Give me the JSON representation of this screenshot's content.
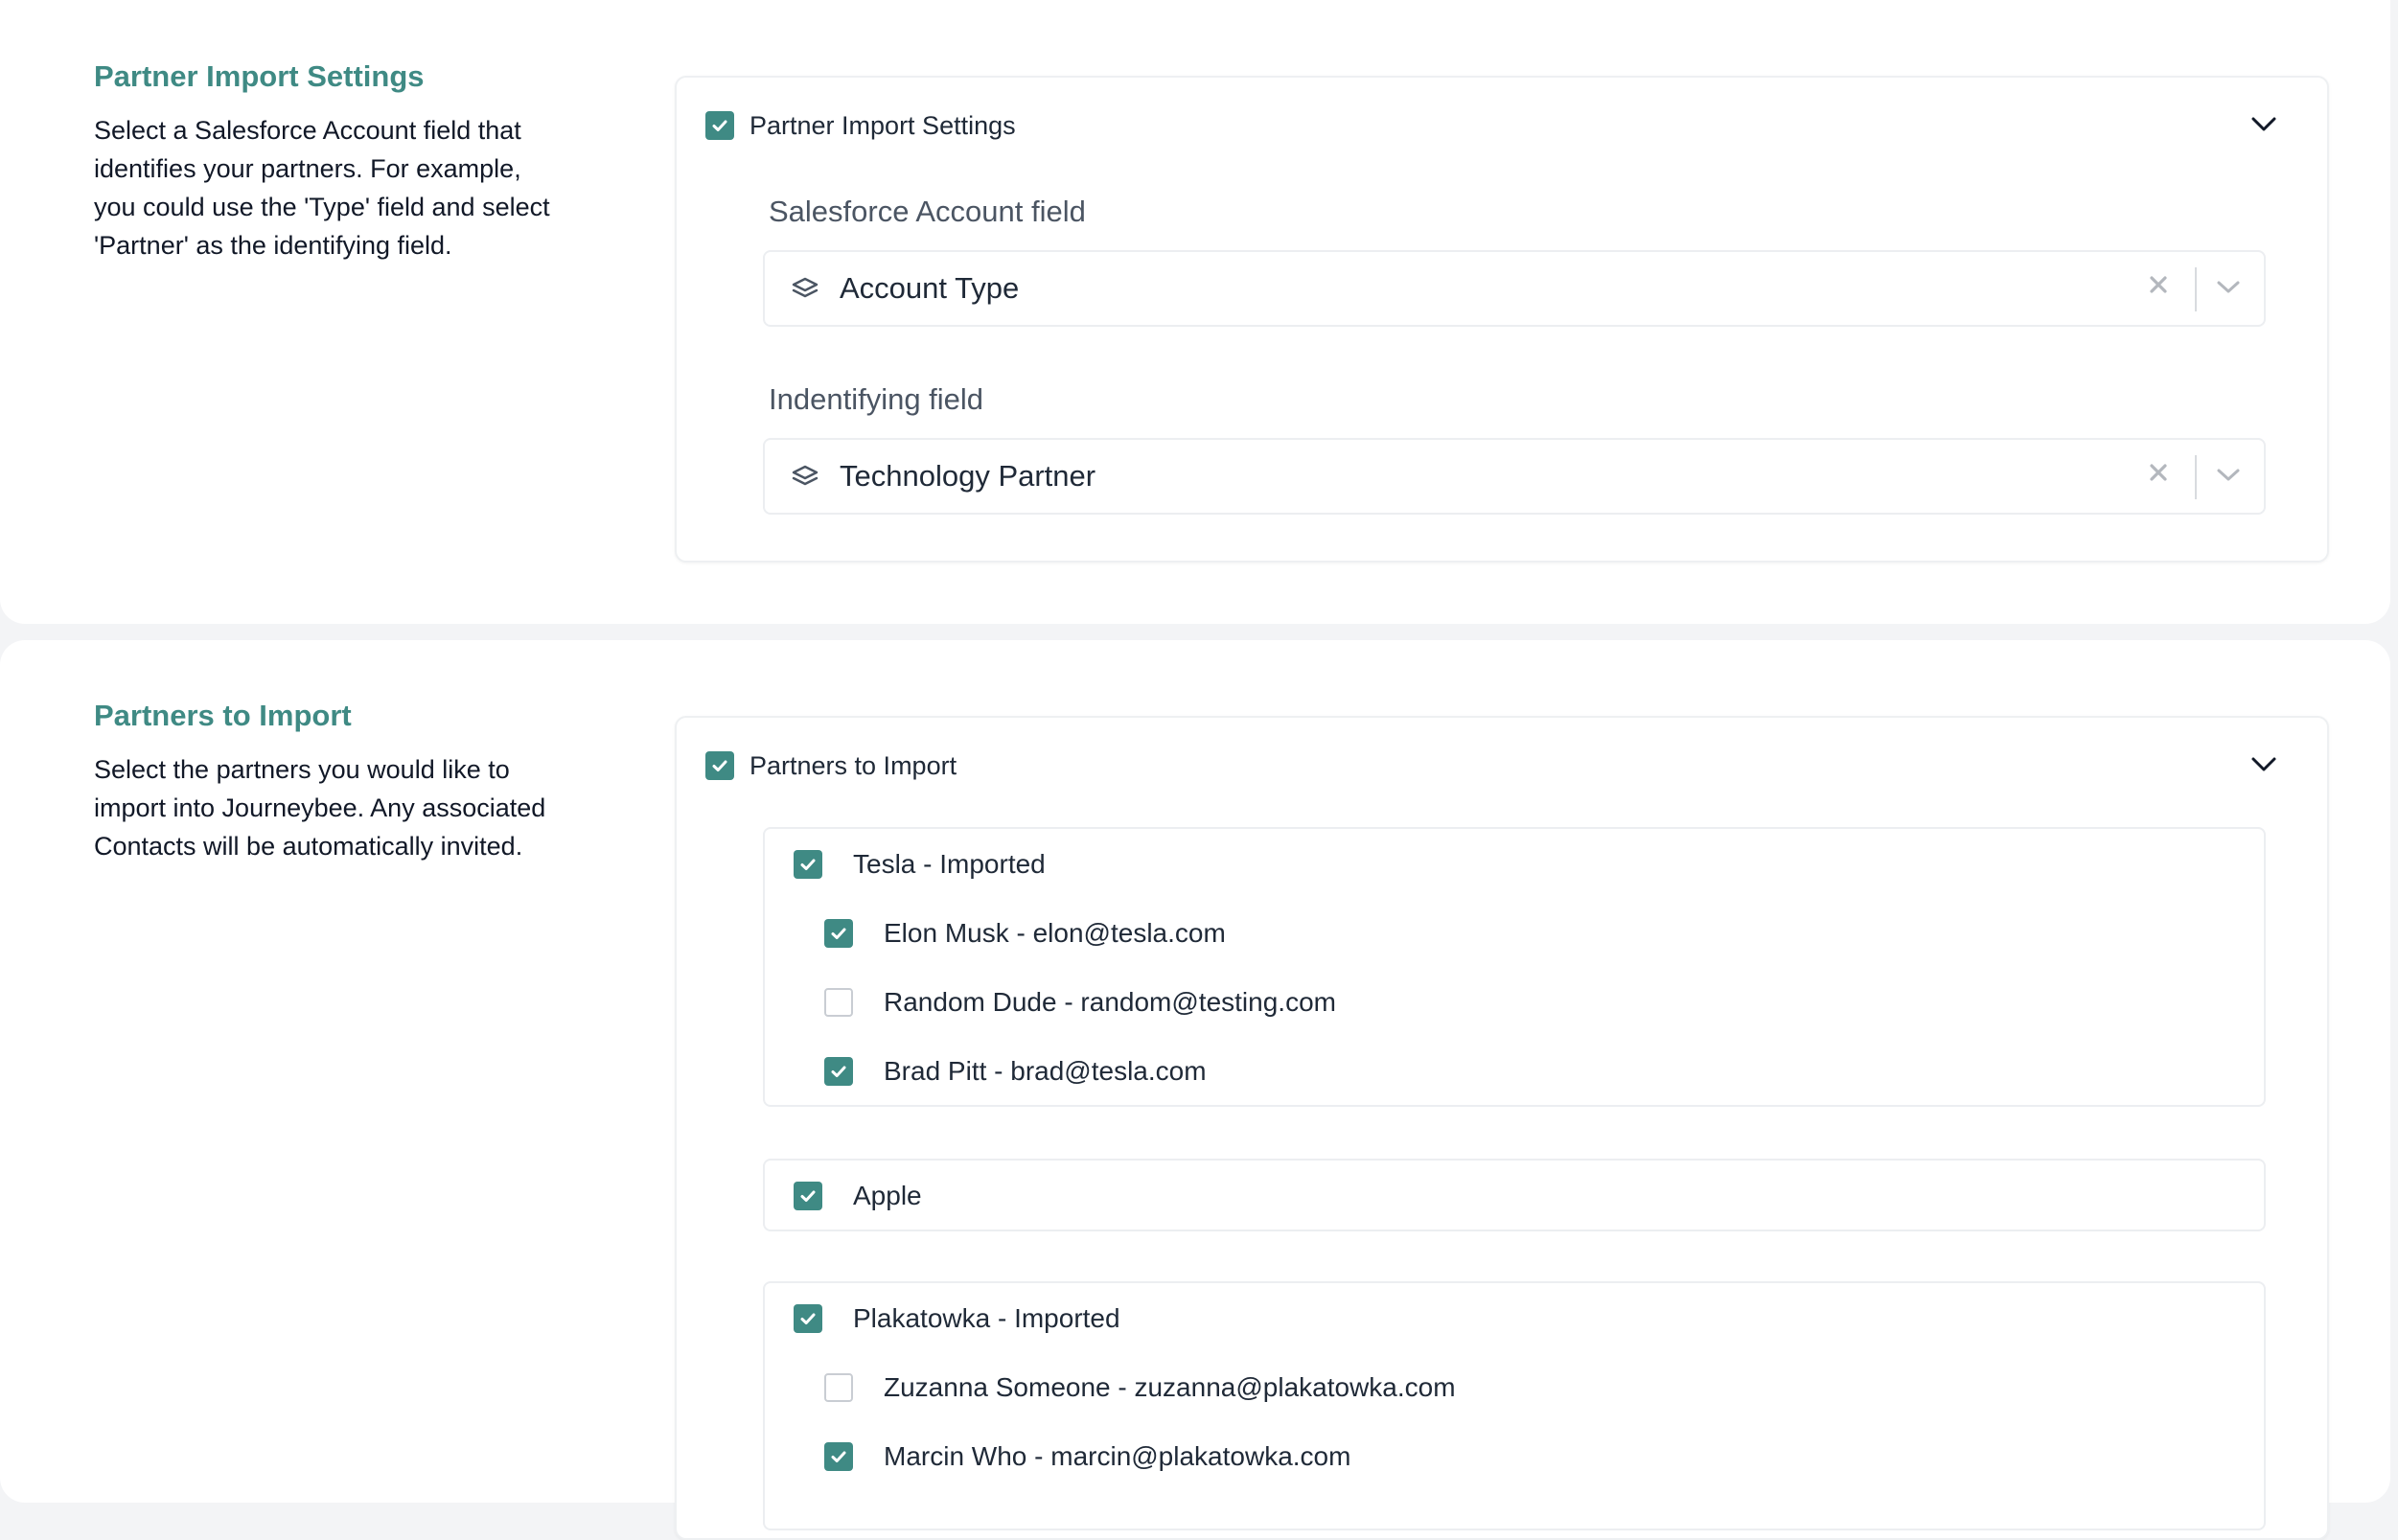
{
  "colors": {
    "accent": "#3f8a84",
    "text": "#111827",
    "muted": "#4b5563"
  },
  "partner_settings": {
    "title": "Partner Import Settings",
    "description": "Select a Salesforce Account field that identifies your partners. For example, you could use the 'Type' field and select 'Partner' as the identifying field.",
    "panel": {
      "toggle_label": "Partner Import Settings",
      "checked": true,
      "fields": [
        {
          "label": "Salesforce Account field",
          "value": "Account Type",
          "icon": "layers-icon"
        },
        {
          "label": "Indentifying field",
          "value": "Technology Partner",
          "icon": "layers-icon"
        }
      ]
    }
  },
  "partners_to_import": {
    "title": "Partners to Import",
    "description": "Select the partners you would like to import into Journeybee. Any associated Contacts will be automatically invited.",
    "panel": {
      "toggle_label": "Partners to Import",
      "checked": true,
      "groups": [
        {
          "name": "Tesla - Imported",
          "checked": true,
          "contacts": [
            {
              "label": "Elon Musk - elon@tesla.com",
              "checked": true
            },
            {
              "label": "Random Dude - random@testing.com",
              "checked": false
            },
            {
              "label": "Brad Pitt - brad@tesla.com",
              "checked": true
            }
          ]
        },
        {
          "name": "Apple",
          "checked": true,
          "contacts": []
        },
        {
          "name": "Plakatowka - Imported",
          "checked": true,
          "contacts": [
            {
              "label": "Zuzanna Someone - zuzanna@plakatowka.com",
              "checked": false
            },
            {
              "label": "Marcin Who - marcin@plakatowka.com",
              "checked": true
            }
          ]
        }
      ]
    }
  }
}
